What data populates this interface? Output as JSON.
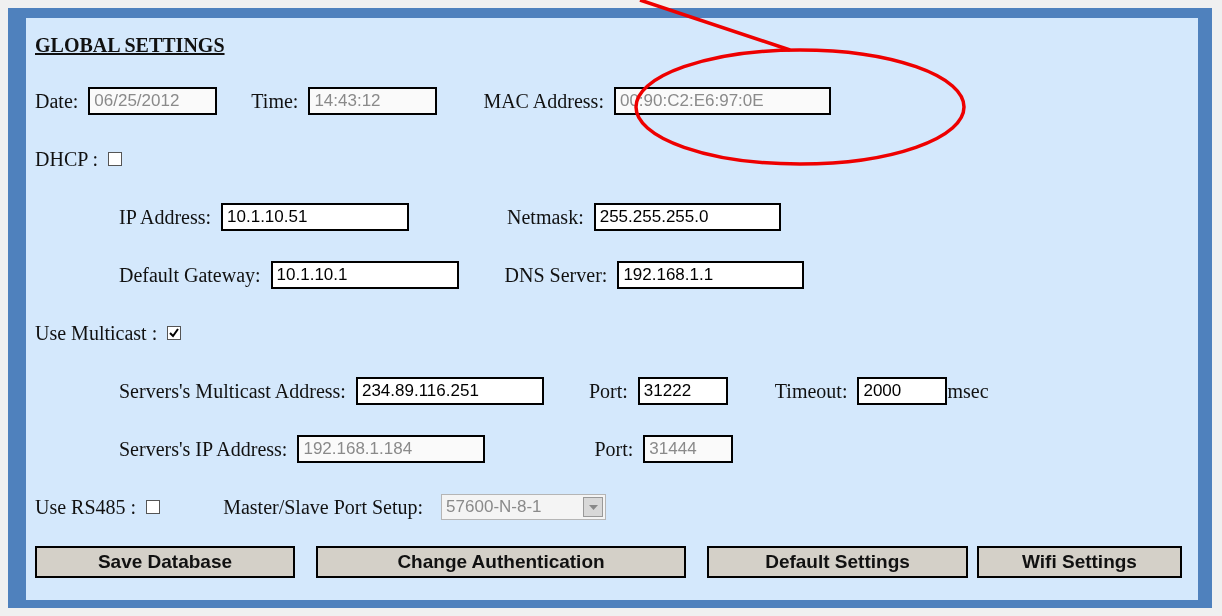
{
  "title": "GLOBAL SETTINGS",
  "rows": [
    {
      "items": [
        {
          "kind": "field",
          "label": "Date:",
          "value": "06/25/2012",
          "disabled": true
        },
        {
          "kind": "field",
          "label": "Time:",
          "value": "14:43:12",
          "disabled": true
        },
        {
          "kind": "field",
          "label": "MAC Address:",
          "value": "00:90:C2:E6:97:0E",
          "disabled": true
        }
      ]
    },
    {
      "items": [
        {
          "kind": "checkbox",
          "label": "DHCP :",
          "checked": false
        }
      ],
      "children": [
        {
          "items": [
            {
              "kind": "field",
              "label": "IP Address:",
              "value": "10.1.10.51",
              "disabled": false
            },
            {
              "kind": "field",
              "label": "Netmask:",
              "value": "255.255.255.0",
              "disabled": false
            }
          ]
        },
        {
          "items": [
            {
              "kind": "field",
              "label": "Default Gateway:",
              "value": "10.1.10.1",
              "disabled": false
            },
            {
              "kind": "field",
              "label": "DNS Server:",
              "value": "192.168.1.1",
              "disabled": false
            }
          ]
        }
      ]
    },
    {
      "items": [
        {
          "kind": "checkbox",
          "label": "Use Multicast :",
          "checked": true
        }
      ],
      "children": [
        {
          "items": [
            {
              "kind": "field",
              "label": "Servers's Multicast Address:",
              "value": "234.89.116.251",
              "disabled": false
            },
            {
              "kind": "field",
              "label": "Port:",
              "value": "31222",
              "disabled": false
            },
            {
              "kind": "field",
              "label": "Timeout:",
              "value": "2000",
              "disabled": false,
              "unit": "msec"
            }
          ]
        },
        {
          "items": [
            {
              "kind": "field",
              "label": "Servers's IP Address:",
              "value": "192.168.1.184",
              "disabled": true
            },
            {
              "kind": "field",
              "label": "Port:",
              "value": "31444",
              "disabled": true
            }
          ]
        }
      ]
    },
    {
      "items": [
        {
          "kind": "checkbox",
          "label": "Use RS485 :",
          "checked": false
        },
        {
          "kind": "select",
          "label": "Master/Slave Port Setup:",
          "value": "57600-N-8-1",
          "disabled": true
        }
      ]
    }
  ],
  "buttons": [
    "Save Database",
    "Change Authentication",
    "Default Settings",
    "Wifi Settings"
  ]
}
